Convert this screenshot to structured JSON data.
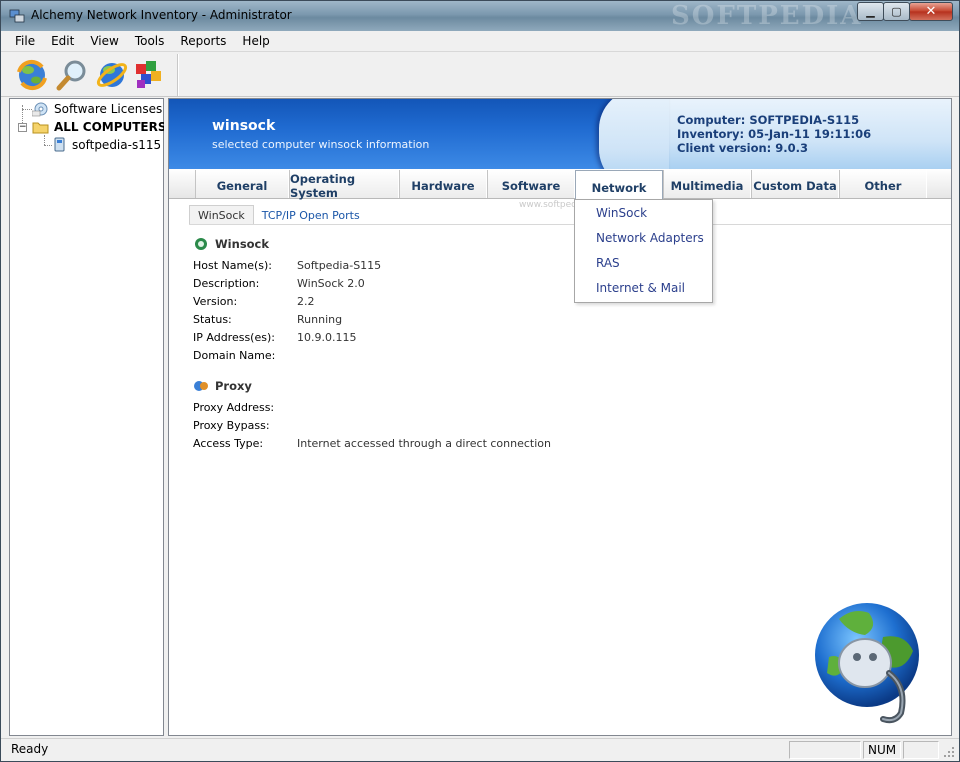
{
  "window": {
    "title": "Alchemy Network Inventory - Administrator",
    "watermark": "SOFTPEDIA"
  },
  "menu": [
    "File",
    "Edit",
    "View",
    "Tools",
    "Reports",
    "Help"
  ],
  "toolbar": {
    "buttons": [
      "refresh-icon",
      "search-icon",
      "internet-explorer-icon",
      "network-blocks-icon"
    ]
  },
  "tree": {
    "items": [
      {
        "label": "Software Licenses",
        "icon": "software-licenses-icon"
      },
      {
        "label": "ALL COMPUTERS",
        "icon": "folder-icon"
      },
      {
        "label": "softpedia-s115",
        "icon": "computer-icon"
      }
    ]
  },
  "header": {
    "title": "winsock",
    "subtitle": "selected computer winsock information",
    "computer": "Computer: SOFTPEDIA-S115",
    "inventory": "Inventory: 05-Jan-11 19:11:06",
    "client_version": "Client version: 9.0.3"
  },
  "tabs": [
    "General",
    "Operating System",
    "Hardware",
    "Software",
    "Network",
    "Multimedia",
    "Custom Data",
    "Other"
  ],
  "active_tab": "Network",
  "subtabs": [
    "WinSock",
    "TCP/IP Open Ports"
  ],
  "tab_watermark": "www.softpedia.com",
  "winsock": {
    "title": "Winsock",
    "fields": [
      {
        "label": "Host Name(s):",
        "value": "Softpedia-S115"
      },
      {
        "label": "Description:",
        "value": "WinSock 2.0"
      },
      {
        "label": "Version:",
        "value": "2.2"
      },
      {
        "label": "Status:",
        "value": "Running"
      },
      {
        "label": "IP Address(es):",
        "value": "10.9.0.115"
      },
      {
        "label": "Domain Name:",
        "value": ""
      }
    ]
  },
  "proxy": {
    "title": "Proxy",
    "fields": [
      {
        "label": "Proxy Address:",
        "value": ""
      },
      {
        "label": "Proxy Bypass:",
        "value": ""
      },
      {
        "label": "Access Type:",
        "value": "Internet accessed through a direct connection"
      }
    ]
  },
  "network_menu": [
    "WinSock",
    "Network Adapters",
    "RAS",
    "Internet & Mail"
  ],
  "status": {
    "text": "Ready",
    "num": "NUM"
  },
  "colors": {
    "header_blue": "#1f6ad0",
    "tab_text": "#1f3f66",
    "link_blue": "#2b3f8c"
  }
}
